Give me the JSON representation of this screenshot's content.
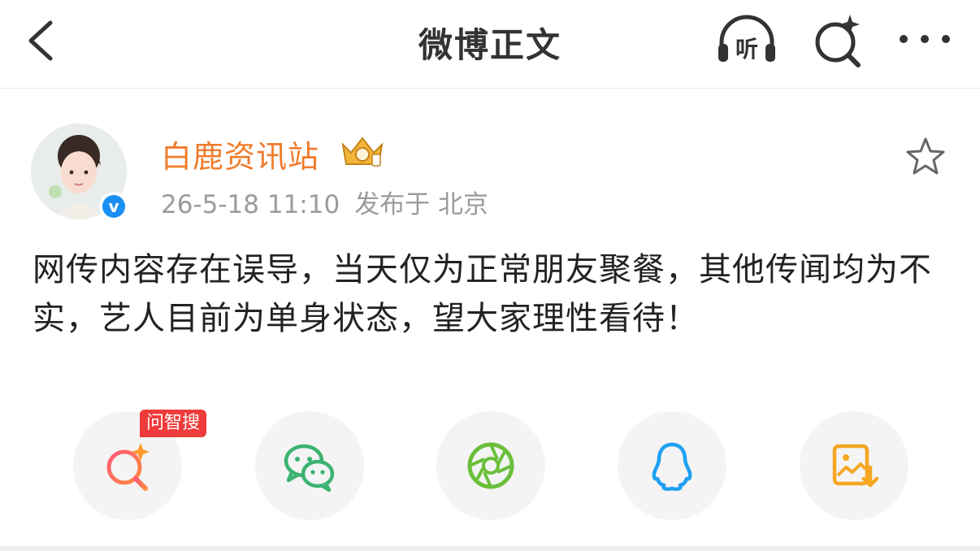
{
  "header": {
    "title": "微博正文",
    "back_icon": "chevron-left-icon",
    "listen_label": "听",
    "search_icon": "ai-search-icon",
    "more_icon": "more-dots-icon"
  },
  "post": {
    "author": "白鹿资讯站",
    "verified_label": "v",
    "timestamp": "26-5-18 11:10",
    "location": "发布于 北京",
    "text": "网传内容存在误导，当天仅为正常朋友聚餐，其他传闻均为不实，艺人目前为单身状态，望大家理性看待！"
  },
  "share": {
    "tag_label": "问智搜",
    "items": [
      {
        "icon": "ai-search-icon"
      },
      {
        "icon": "wechat-icon"
      },
      {
        "icon": "moments-icon"
      },
      {
        "icon": "qq-icon"
      },
      {
        "icon": "save-image-icon"
      }
    ]
  },
  "colors": {
    "author": "#f07c2c",
    "verified": "#1a8ff2",
    "tag": "#ef3b3b",
    "wechat": "#3cb371",
    "qq": "#1ea0f2",
    "save": "#f5a623"
  }
}
